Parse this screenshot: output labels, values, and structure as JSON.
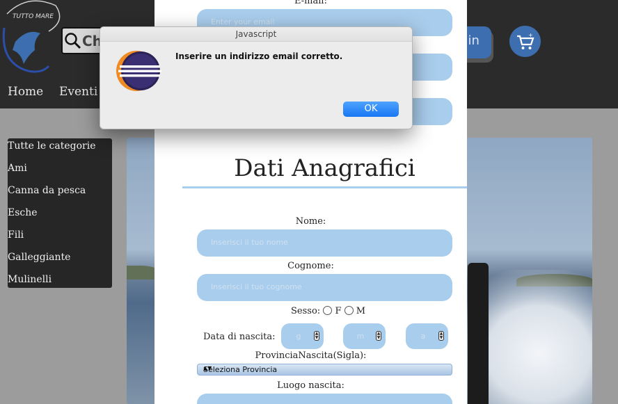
{
  "header": {
    "logo_text": "TUTTO MARE",
    "search_placeholder": "Ch",
    "login_label": "ogin",
    "nav": [
      "Home",
      "Eventi"
    ]
  },
  "sidebar": {
    "items": [
      "Tutte le categorie",
      "Ami",
      "Canna da pesca",
      "Esche",
      "Fili",
      "Galleggiante",
      "Mulinelli"
    ]
  },
  "form": {
    "email_label": "E-mail:",
    "email_placeholder": "Enter your email",
    "section_title": "Dati Anagrafici",
    "nome_label": "Nome:",
    "nome_placeholder": "Inserisci il tuo nome",
    "cognome_label": "Cognome:",
    "cognome_placeholder": "Inserisci il tuo cognome",
    "sesso_label": "Sesso:",
    "sesso_f": "F",
    "sesso_m": "M",
    "data_label": "Data di nascita:",
    "day_placeholder": "g",
    "month_placeholder": "m",
    "year_placeholder": "a",
    "provincia_label": "ProvinciaNascita(Sigla):",
    "provincia_selected": "Seleziona Provincia",
    "luogo_label": "Luogo nascita:"
  },
  "dialog": {
    "title": "Javascript",
    "message": "Inserire un indirizzo email corretto.",
    "ok_label": "OK"
  },
  "colors": {
    "field_bg": "#a9cdec",
    "header_bg": "#2b2b2b",
    "accent_blue": "#3d6fb0",
    "ok_button": "#1776f2"
  }
}
